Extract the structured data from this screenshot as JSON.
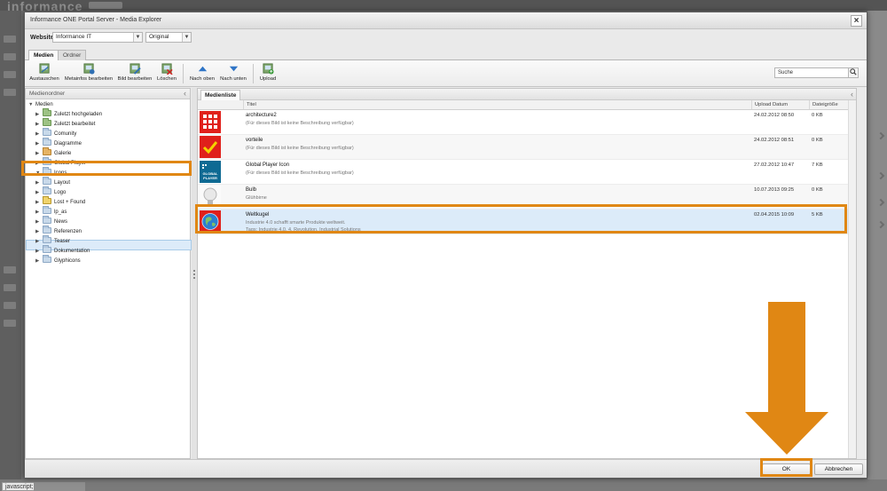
{
  "background": {
    "logo_text": "informance",
    "status_text": "javascript;"
  },
  "dialog": {
    "title": "Informance ONE Portal Server - Media Explorer",
    "website_label": "Website",
    "website_value": "Informance IT",
    "version_value": "Original",
    "tabs": [
      {
        "label": "Medien",
        "active": true
      },
      {
        "label": "Ordner",
        "active": false
      }
    ],
    "toolbar": [
      {
        "label": "Austauschen",
        "icon": "replace-icon"
      },
      {
        "label": "Metainfos bearbeiten",
        "icon": "edit-metadata-icon"
      },
      {
        "label": "Bild bearbeiten",
        "icon": "edit-image-icon"
      },
      {
        "label": "Löschen",
        "icon": "delete-icon"
      },
      {
        "label": "Nach oben",
        "icon": "arrow-up-icon"
      },
      {
        "label": "Nach unten",
        "icon": "arrow-down-icon"
      },
      {
        "label": "Upload",
        "icon": "upload-icon"
      }
    ],
    "search_value": "Suche",
    "left_panel": {
      "title": "Medienordner",
      "root": "Medien",
      "folders": [
        "Zuletzt hochgeladen",
        "Zuletzt bearbeitet",
        "Comunity",
        "Diagramme",
        "Galerie",
        "Global Player",
        "Icons",
        "Layout",
        "Logo",
        "Lost + Found",
        "lp_as",
        "News",
        "Referenzen",
        "Teaser",
        "Dokumentation",
        "Glyphicons"
      ],
      "selected_folder": "Icons"
    },
    "right_panel": {
      "tab": "Medienliste",
      "columns": {
        "title": "Titel",
        "date": "Upload Datum",
        "size": "Dateigröße"
      },
      "rows": [
        {
          "title": "architecture2",
          "description": "(Für dieses Bild ist keine Beschreibung verfügbar)",
          "tags": "",
          "date": "24.02.2012 08:50",
          "size": "0 KB",
          "thumb": "architecture-thumbnail"
        },
        {
          "title": "vorteile",
          "description": "(Für dieses Bild ist keine Beschreibung verfügbar)",
          "tags": "",
          "date": "24.02.2012 08:51",
          "size": "0 KB",
          "thumb": "checkmark-thumbnail"
        },
        {
          "title": "Global Player Icon",
          "description": "(Für dieses Bild ist keine Beschreibung verfügbar)",
          "tags": "",
          "date": "27.02.2012 10:47",
          "size": "7 KB",
          "thumb": "global-player-thumbnail",
          "thumb_text": "GLOBAL PLAYER"
        },
        {
          "title": "Bulb",
          "description": "Glühbirne",
          "tags": "",
          "date": "10.07.2013 09:25",
          "size": "0 KB",
          "thumb": "bulb-thumbnail"
        },
        {
          "title": "Weltkugel",
          "description": "Industrie 4.0 schafft smarte Produkte weltweit.",
          "tags": "Tags: Industrie 4.0, 4. Revolution, Industrial Solutions",
          "date": "02.04.2015 10:09",
          "size": "5 KB",
          "thumb": "globe-thumbnail"
        }
      ],
      "selected_row": "Weltkugel"
    },
    "ok_label": "OK",
    "cancel_label": "Abbrechen"
  },
  "colors": {
    "highlight": "#e08714",
    "selection": "#dcebf9"
  }
}
